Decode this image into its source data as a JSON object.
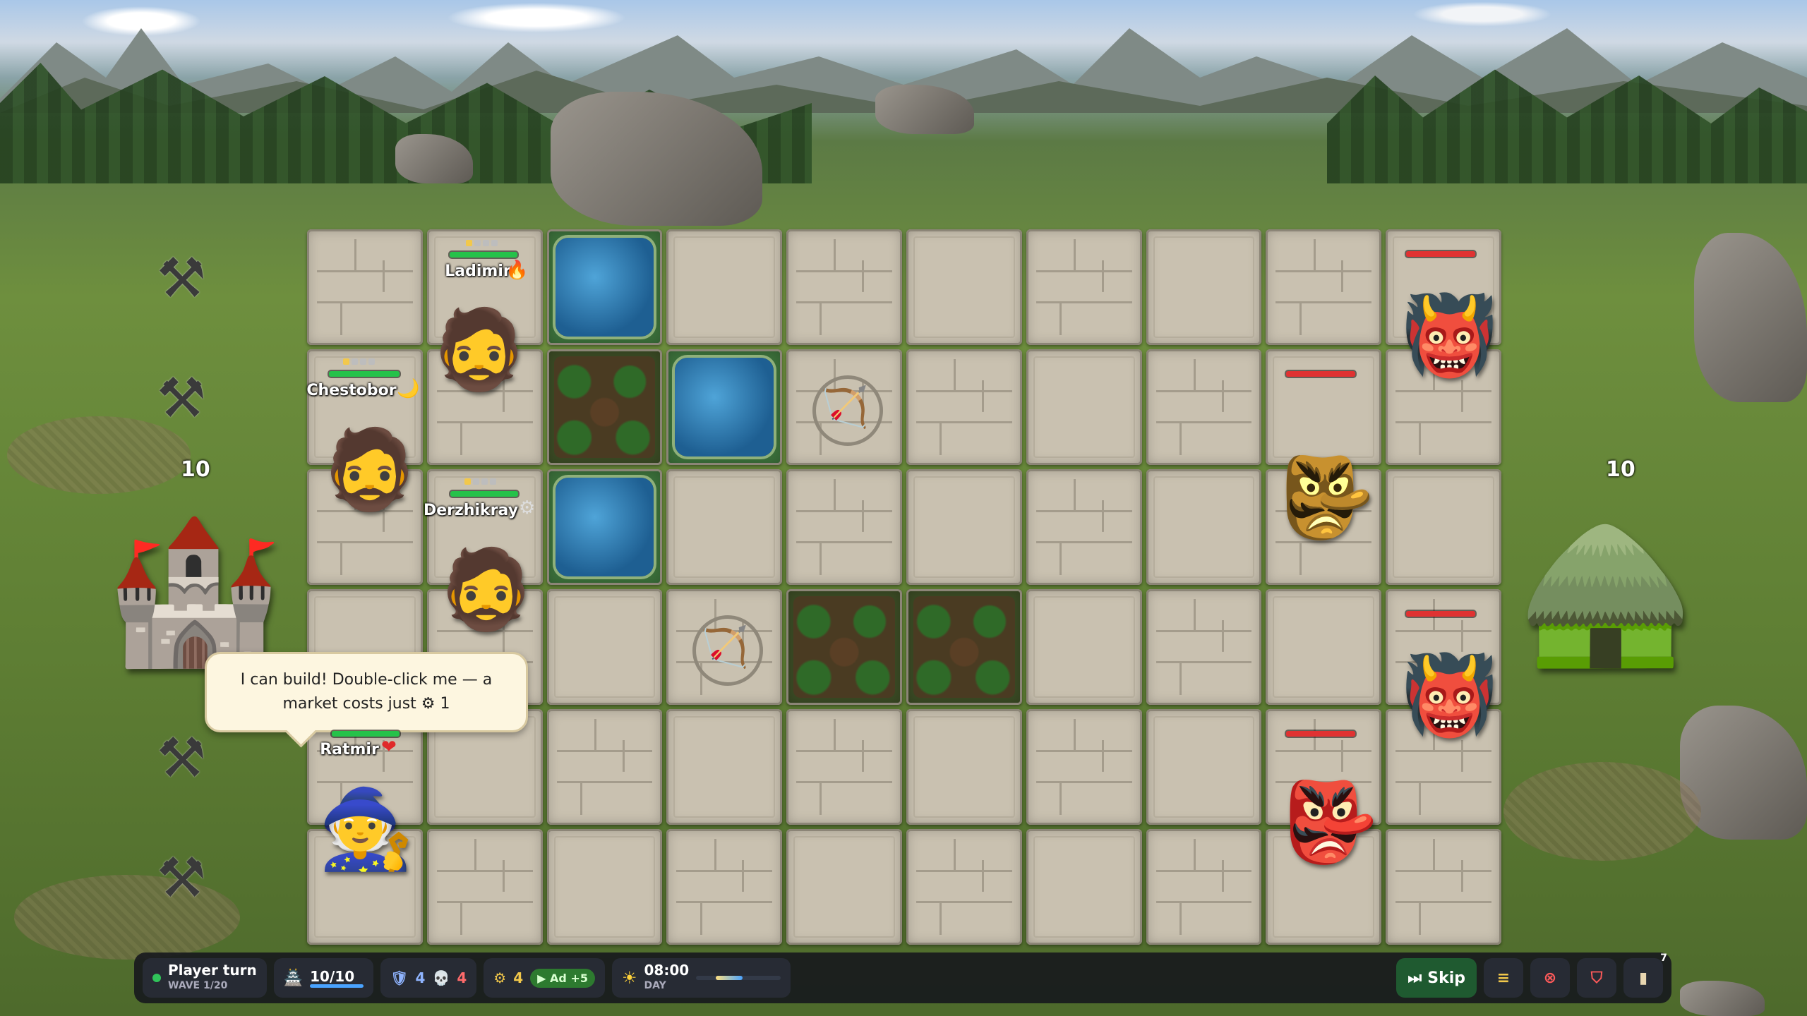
{
  "units": {
    "ladimir": {
      "name": "Ladimir",
      "status_icon": "fire-icon",
      "glyph": "🔥"
    },
    "chestobor": {
      "name": "Chestobor",
      "status_icon": "moon-icon",
      "glyph": "🌙"
    },
    "derzhikray": {
      "name": "Derzhikray",
      "status_icon": "gear-icon",
      "glyph": "⚙"
    },
    "ratmir": {
      "name": "Ratmir",
      "status_icon": "heart-icon",
      "glyph": "❤"
    }
  },
  "bases": {
    "player_hp": "10",
    "enemy_hp": "10"
  },
  "bubble": {
    "line1": "I can build! Double-click me — a",
    "line2": "market costs just ⚙ 1"
  },
  "hud": {
    "turn_label": "Player turn",
    "wave_label": "WAVE 1/20",
    "castle_hp": "10/10",
    "shield_count": "4",
    "skull_count": "4",
    "gear_count": "4",
    "ad_label": "▶ Ad +5",
    "time": "08:00",
    "time_phase": "DAY",
    "skip_label": "Skip",
    "cards_count": "7"
  },
  "colors": {
    "hp_player": "#25c24a",
    "hp_enemy": "#e03232",
    "accent_skip": "#1f5a30",
    "hud_bg": "#14161c"
  }
}
